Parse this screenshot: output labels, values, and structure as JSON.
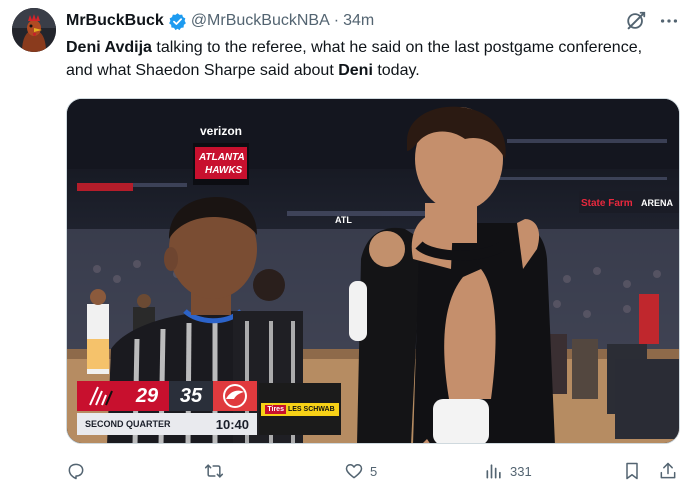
{
  "tweet": {
    "author_name": "MrBuckBuck",
    "handle": "@MrBuckBuckNBA",
    "separator": "·",
    "time": "34m",
    "text_parts": [
      {
        "text": "Deni Avdija",
        "bold": true
      },
      {
        "text": " talking to the referee, what he said on the last postgame conference, and what Shaedon Sharpe said about ",
        "bold": false
      },
      {
        "text": "Deni",
        "bold": true
      },
      {
        "text": " today.",
        "bold": false
      }
    ]
  },
  "media": {
    "signage": {
      "verizon": "verizon",
      "hawks_top": "ATLANTA",
      "hawks_bottom": "HAWKS",
      "statefarm": "State Farm",
      "arena": "ARENA",
      "atl": "ATL"
    },
    "scoreboard": {
      "away_score": "29",
      "home_score": "35",
      "quarter": "SECOND QUARTER",
      "clock": "10:40",
      "sponsor_a": "Tires",
      "sponsor_b": "LES SCHWAB"
    }
  },
  "actions": {
    "reply_count": "",
    "retweet_count": "",
    "like_count": "5",
    "views_count": "331"
  },
  "icons": {
    "verified": "verified-badge-icon",
    "grok": "grok-icon",
    "more": "more-icon",
    "reply": "reply-icon",
    "retweet": "retweet-icon",
    "like": "heart-icon",
    "views": "views-icon",
    "bookmark": "bookmark-icon",
    "share": "share-icon"
  },
  "colors": {
    "secondary_text": "#536471",
    "verified_blue": "#1d9bf0",
    "blazers_red": "#c8102e",
    "hawks_red": "#e03a3e"
  }
}
